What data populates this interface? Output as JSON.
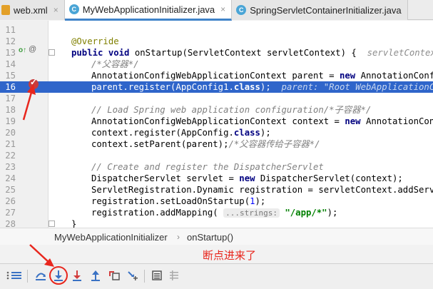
{
  "tabs": [
    {
      "label": "web.xml",
      "icon": "xml-file-icon",
      "active": false
    },
    {
      "label": "MyWebApplicationInitializer.java",
      "icon": "java-class-icon",
      "active": true
    },
    {
      "label": "SpringServletContainerInitializer.java",
      "icon": "java-class-icon",
      "active": false
    }
  ],
  "editor": {
    "line_numbers": [
      "11",
      "12",
      "13",
      "14",
      "15",
      "16",
      "17",
      "18",
      "19",
      "20",
      "21",
      "22",
      "23",
      "24",
      "25",
      "26",
      "27",
      "28"
    ],
    "lines": {
      "l12_ann": "@Override",
      "l13_kw1": "public",
      "l13_kw2": "void",
      "l13_code": " onStartup(ServletContext servletContext) {",
      "l13_hint": "servletContext: A",
      "l14_cmt": "/*父容器*/",
      "l15_code": "AnnotationConfigWebApplicationContext parent = ",
      "l15_kw": "new",
      "l15_code2": " AnnotationConfigWe",
      "l16_code": "parent.register(AppConfig1.",
      "l16_kw": "class",
      "l16_code2": ");",
      "l16_hint": "parent: \"Root WebApplicationConte",
      "l18_cmt": "// Load Spring web application configuration/*子容器*/",
      "l19_code": "AnnotationConfigWebApplicationContext context = ",
      "l19_kw": "new",
      "l19_code2": " AnnotationConfigWe",
      "l20_code": "context.register(AppConfig.",
      "l20_kw": "class",
      "l20_code2": ");",
      "l21_code": "context.setParent(parent);",
      "l21_cmt": "/*父容器传给子容器*/",
      "l23_cmt": "// Create and register the DispatcherServlet",
      "l24_code": "DispatcherServlet servlet = ",
      "l24_kw": "new",
      "l24_code2": " DispatcherServlet(context);",
      "l25_code": "ServletRegistration.Dynamic registration = servletContext.addServlet(",
      "l26_code": "registration.setLoadOnStartup(",
      "l26_num": "1",
      "l26_code2": ");",
      "l27_code": "registration.addMapping(",
      "l27_inlay": "...strings:",
      "l27_str": "\"/app/*\"",
      "l27_code2": ");",
      "l28_code": "}"
    },
    "current_line": "16"
  },
  "breadcrumb": [
    "MyWebApplicationInitializer",
    "onStartup()"
  ],
  "annotation": "断点进来了",
  "toolbar_icons": [
    "restore-layout-icon",
    "show-execution-point-icon",
    "step-over-icon",
    "step-into-icon",
    "force-step-into-icon",
    "step-out-icon",
    "drop-frame-icon",
    "run-to-cursor-icon",
    "evaluate-expression-icon",
    "trace-icon"
  ],
  "colors": {
    "highlight": "#2f65ca",
    "keyword": "#000080",
    "annotation_red": "#e8261d",
    "comment": "#808080",
    "breakpoint": "#c93b3b"
  }
}
